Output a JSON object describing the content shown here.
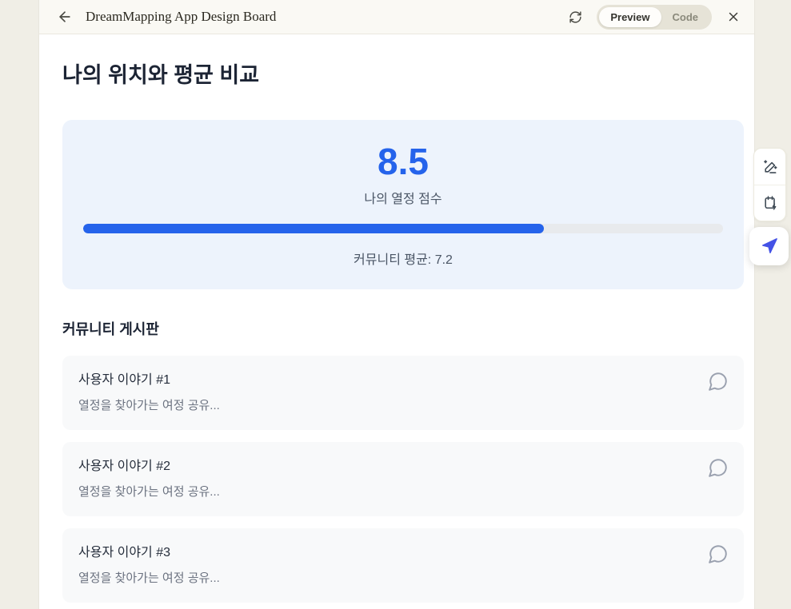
{
  "header": {
    "title": "DreamMapping App Design Board",
    "toggle": {
      "preview_label": "Preview",
      "code_label": "Code",
      "active": "Preview"
    }
  },
  "page": {
    "heading": "나의 위치와 평균 비교",
    "score_card": {
      "score": "8.5",
      "score_label": "나의 열정 점수",
      "progress_percent": 72,
      "average_label": "커뮤니티 평균: 7.2"
    },
    "board": {
      "heading": "커뮤니티 게시판",
      "posts": [
        {
          "title": "사용자 이야기 #1",
          "excerpt": "열정을 찾아가는 여정 공유..."
        },
        {
          "title": "사용자 이야기 #2",
          "excerpt": "열정을 찾아가는 여정 공유..."
        },
        {
          "title": "사용자 이야기 #3",
          "excerpt": "열정을 찾아가는 여정 공유..."
        }
      ]
    }
  },
  "toolbar": {
    "icons": [
      "edit-sparkle",
      "clipboard-zap",
      "send"
    ]
  },
  "colors": {
    "accent_blue": "#2563eb",
    "nav_icon_blue": "#4452e6",
    "score_card_bg": "#edf3fc",
    "app_bg": "#f0eee6",
    "header_bg": "#faf9f4"
  }
}
